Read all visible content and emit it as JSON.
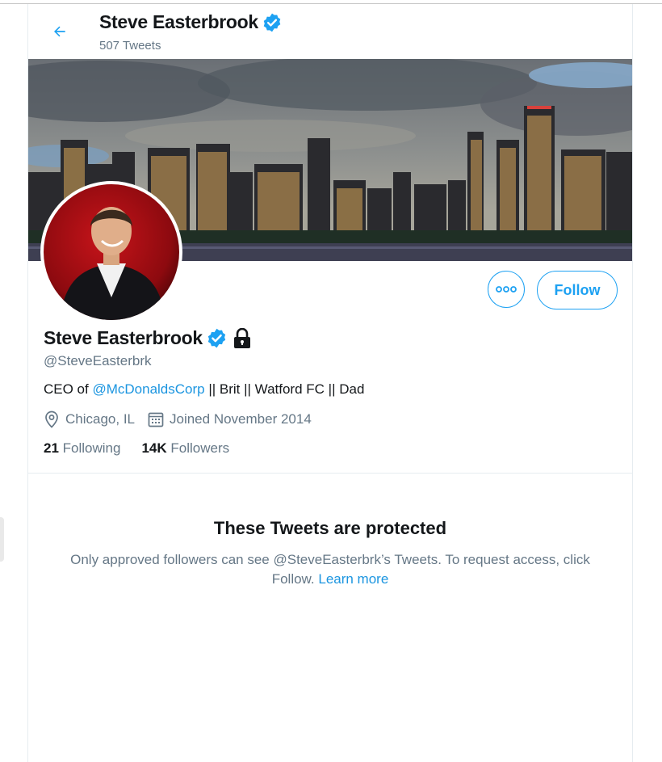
{
  "header": {
    "name": "Steve Easterbrook",
    "tweet_count": "507 Tweets"
  },
  "profile": {
    "name": "Steve Easterbrook",
    "handle": "@SteveEasterbrk",
    "bio_prefix": "CEO of ",
    "bio_mention": "@McDonaldsCorp",
    "bio_suffix": " || Brit || Watford FC || Dad",
    "location": "Chicago, IL",
    "joined": "Joined November 2014",
    "following_count": "21",
    "following_label": "Following",
    "followers_count": "14K",
    "followers_label": "Followers"
  },
  "actions": {
    "follow_label": "Follow"
  },
  "protected": {
    "title": "These Tweets are protected",
    "text": "Only approved followers can see @SteveEasterbrk’s Tweets. To request access, click Follow.",
    "learn_more": "Learn more"
  },
  "colors": {
    "accent": "#1da1f2",
    "link": "#1b95e0",
    "secondary_text": "#657786"
  },
  "icons": [
    "back-arrow-icon",
    "verified-badge-icon",
    "lock-icon",
    "more-options-icon",
    "location-pin-icon",
    "calendar-icon"
  ]
}
